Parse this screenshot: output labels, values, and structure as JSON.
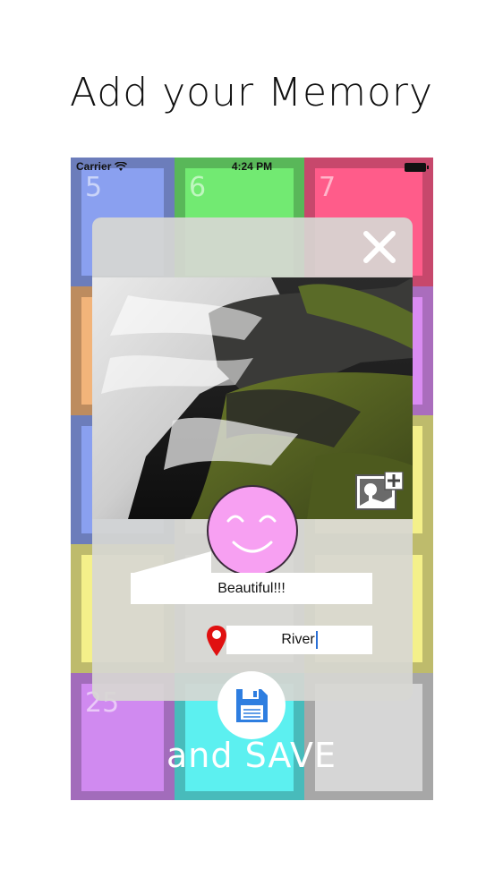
{
  "headline": "Add your Memory",
  "status_bar": {
    "carrier": "Carrier",
    "time": "4:24 PM"
  },
  "tiles": [
    {
      "number": "5",
      "color": "#8aa0f0",
      "row": 0,
      "col": 0
    },
    {
      "number": "6",
      "color": "#72ea72",
      "row": 0,
      "col": 1
    },
    {
      "number": "7",
      "color": "#ff5c8a",
      "row": 0,
      "col": 2
    },
    {
      "number": "",
      "color": "#f2b47a",
      "row": 1,
      "col": 0
    },
    {
      "number": "",
      "color": "#dcdcdc",
      "row": 1,
      "col": 1
    },
    {
      "number": "",
      "color": "#da8cf2",
      "row": 1,
      "col": 2
    },
    {
      "number": "",
      "color": "#8aa0f0",
      "row": 2,
      "col": 0
    },
    {
      "number": "",
      "color": "#dcdcdc",
      "row": 2,
      "col": 1
    },
    {
      "number": "",
      "color": "#f4f08a",
      "row": 2,
      "col": 2
    },
    {
      "number": "",
      "color": "#f4f08a",
      "row": 3,
      "col": 0
    },
    {
      "number": "",
      "color": "#dcdcdc",
      "row": 3,
      "col": 1
    },
    {
      "number": "",
      "color": "#f4f08a",
      "row": 3,
      "col": 2
    },
    {
      "number": "25",
      "color": "#d08af0",
      "row": 4,
      "col": 0
    },
    {
      "number": "",
      "color": "#5cf0f0",
      "row": 4,
      "col": 1
    },
    {
      "number": "",
      "color": "#d6d6d6",
      "row": 4,
      "col": 2
    }
  ],
  "memory_form": {
    "caption_value": "Beautiful!!!",
    "location_value": "River",
    "mood_face_color": "#f7a0f2"
  },
  "save_label": "and SAVE",
  "colors": {
    "save_icon": "#2e7ee0",
    "pin": "#e01010"
  }
}
